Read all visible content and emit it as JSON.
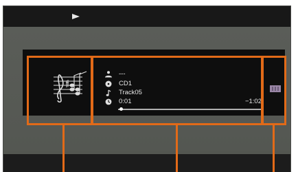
{
  "transport": {
    "state_icon": "play-icon"
  },
  "now_playing": {
    "artist": "---",
    "album": "CD1",
    "track": "Track05",
    "elapsed": "0:01",
    "remaining": "−1:02",
    "progress_fraction": 0.02
  },
  "icons": {
    "artist": "person-icon",
    "album": "disc-icon",
    "track": "music-note-icon",
    "time": "clock-icon",
    "art": "treble-clef-score-icon",
    "side": "film-strip-icon"
  },
  "colors": {
    "callout": "#e26a18",
    "background": "#535650",
    "player_panel": "#0e0e0e",
    "text": "#e8e8e8"
  }
}
